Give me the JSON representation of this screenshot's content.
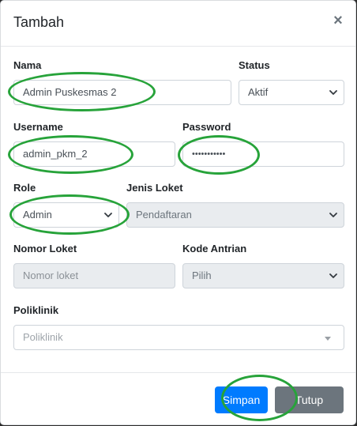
{
  "modal": {
    "title": "Tambah",
    "close_glyph": "×"
  },
  "form": {
    "nama": {
      "label": "Nama",
      "value": "Admin Puskesmas 2"
    },
    "status": {
      "label": "Status",
      "selected": "Aktif"
    },
    "username": {
      "label": "Username",
      "value": "admin_pkm_2"
    },
    "password": {
      "label": "Password",
      "value": "•••••••••••"
    },
    "role": {
      "label": "Role",
      "selected": "Admin"
    },
    "jenis_loket": {
      "label": "Jenis Loket",
      "selected": "Pendaftaran"
    },
    "nomor_loket": {
      "label": "Nomor Loket",
      "placeholder": "Nomor loket"
    },
    "kode_antrian": {
      "label": "Kode Antrian",
      "selected": "Pilih"
    },
    "poliklinik": {
      "label": "Poliklinik",
      "placeholder": "Poliklinik"
    }
  },
  "footer": {
    "save_label": "Simpan",
    "close_label": "Tutup"
  },
  "colors": {
    "primary": "#007bff",
    "secondary": "#6c757d",
    "annotation": "#27a33a"
  },
  "icons": {
    "close": "close-icon",
    "select_chevron": "chevron-down-icon",
    "dropdown_caret": "caret-down-icon"
  }
}
